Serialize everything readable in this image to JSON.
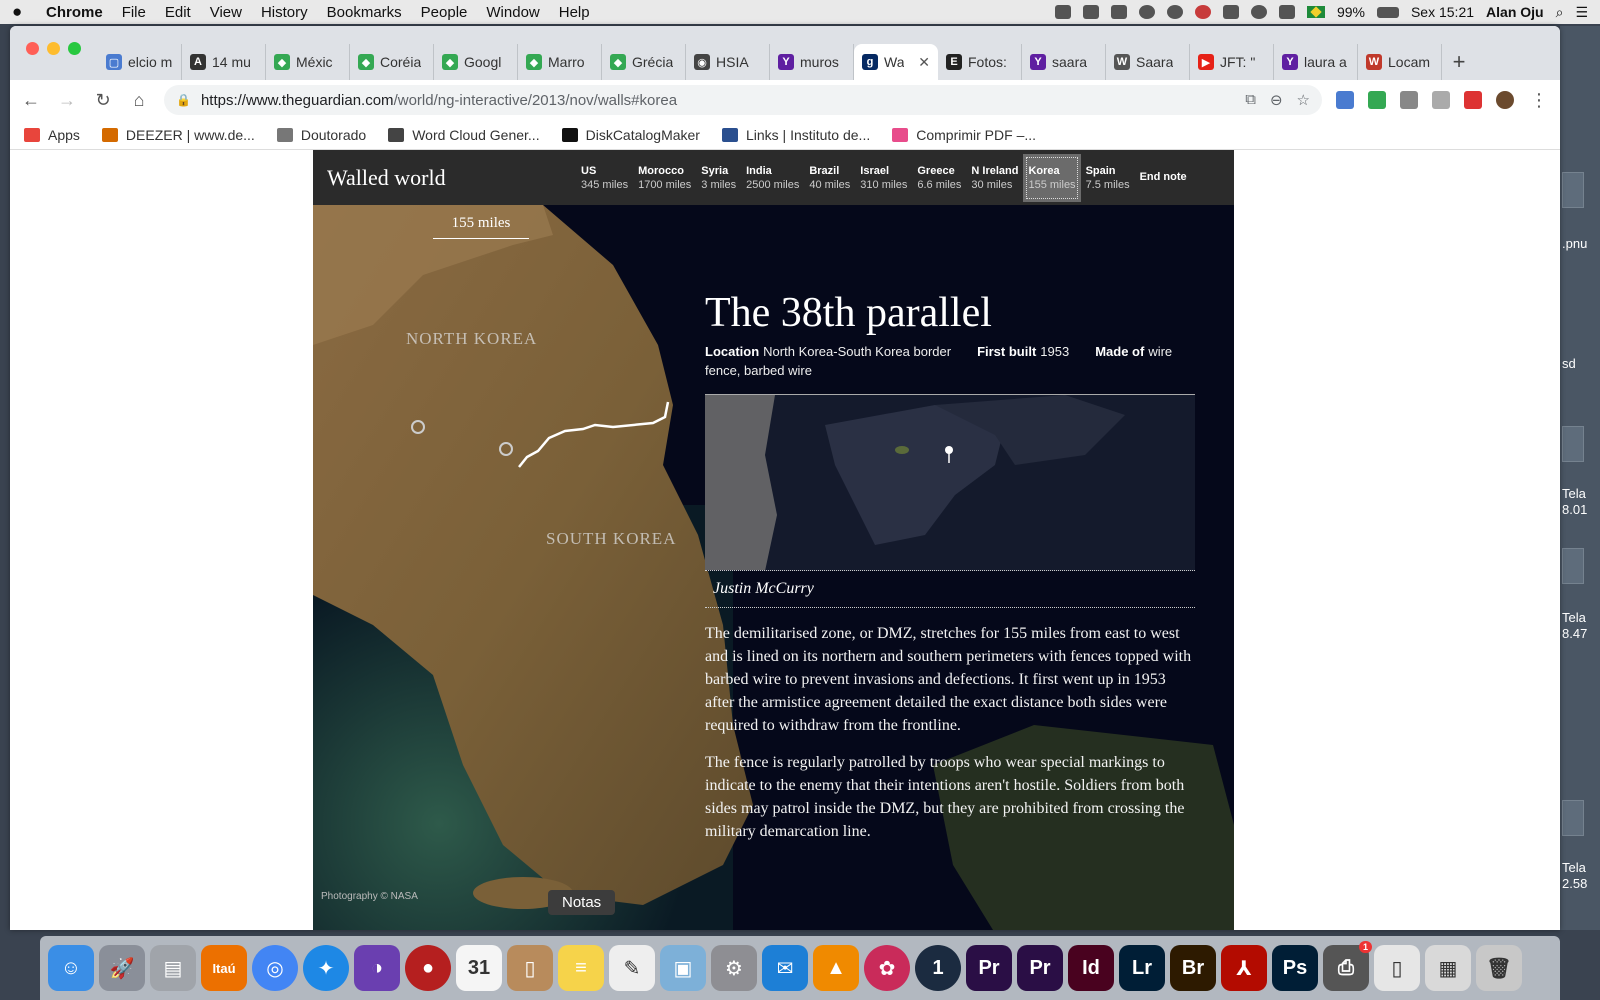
{
  "menubar": {
    "app": "Chrome",
    "items": [
      "File",
      "Edit",
      "View",
      "History",
      "Bookmarks",
      "People",
      "Window",
      "Help"
    ],
    "battery": "99%",
    "clock": "Sex 15:21",
    "user": "Alan Oju"
  },
  "tabs": [
    {
      "label": "elcio m",
      "color": "#4a7bd0",
      "glyph": "▢"
    },
    {
      "label": "14 mu",
      "color": "#333333",
      "glyph": "A"
    },
    {
      "label": "Méxic",
      "color": "#34a853",
      "glyph": "◆"
    },
    {
      "label": "Coréia",
      "color": "#34a853",
      "glyph": "◆"
    },
    {
      "label": "Googl",
      "color": "#34a853",
      "glyph": "◆"
    },
    {
      "label": "Marro",
      "color": "#34a853",
      "glyph": "◆"
    },
    {
      "label": "Grécia",
      "color": "#34a853",
      "glyph": "◆"
    },
    {
      "label": "HSIA",
      "color": "#444444",
      "glyph": "◉"
    },
    {
      "label": "muros",
      "color": "#5f1fa1",
      "glyph": "Y"
    },
    {
      "label": "Wa",
      "color": "#052962",
      "glyph": "g",
      "active": true
    },
    {
      "label": "Fotos:",
      "color": "#222222",
      "glyph": "E"
    },
    {
      "label": "saara",
      "color": "#5f1fa1",
      "glyph": "Y"
    },
    {
      "label": "Saara",
      "color": "#555555",
      "glyph": "W"
    },
    {
      "label": "JFT: \"",
      "color": "#e62117",
      "glyph": "▶"
    },
    {
      "label": "laura a",
      "color": "#5f1fa1",
      "glyph": "Y"
    },
    {
      "label": "Locam",
      "color": "#c0392b",
      "glyph": "W"
    }
  ],
  "address": {
    "host": "https://www.theguardian.com",
    "path": "/world/ng-interactive/2013/nov/walls#korea"
  },
  "bookmarks": [
    {
      "label": "Apps",
      "color": "#e8453c"
    },
    {
      "label": "DEEZER | www.de...",
      "color": "#d46a00"
    },
    {
      "label": "Doutorado",
      "color": "#777777"
    },
    {
      "label": "Word Cloud Gener...",
      "color": "#444444"
    },
    {
      "label": "DiskCatalogMaker",
      "color": "#111111"
    },
    {
      "label": "Links | Instituto de...",
      "color": "#2a4f8f"
    },
    {
      "label": "Comprimir PDF –...",
      "color": "#e84c8b"
    }
  ],
  "article": {
    "site_title": "Walled world",
    "nav": [
      {
        "name": "US",
        "miles": "345 miles"
      },
      {
        "name": "Morocco",
        "miles": "1700 miles"
      },
      {
        "name": "Syria",
        "miles": "3 miles"
      },
      {
        "name": "India",
        "miles": "2500 miles"
      },
      {
        "name": "Brazil",
        "miles": "40 miles"
      },
      {
        "name": "Israel",
        "miles": "310 miles"
      },
      {
        "name": "Greece",
        "miles": "6.6 miles"
      },
      {
        "name": "N Ireland",
        "miles": "30 miles"
      },
      {
        "name": "Korea",
        "miles": "155 miles",
        "active": true
      },
      {
        "name": "Spain",
        "miles": "7.5 miles"
      },
      {
        "name": "End note",
        "miles": ""
      }
    ],
    "miles_tag": "155 miles",
    "map_label_north": "NORTH KOREA",
    "map_label_south": "SOUTH KOREA",
    "credit": "Photography © NASA",
    "headline": "The 38th parallel",
    "location_label": "Location",
    "location_value": "North Korea-South Korea border",
    "first_built_label": "First built",
    "first_built_value": "1953",
    "made_of_label": "Made of",
    "made_of_value": "wire fence, barbed wire",
    "byline": "Justin McCurry",
    "paragraphs": [
      "The demilitarised zone, or DMZ, stretches for 155 miles from east to west and is lined on its northern and southern perimeters with fences topped with barbed wire to prevent invasions and defections. It first went up in 1953 after the armistice agreement detailed the exact distance both sides were required to withdraw from the frontline.",
      "The fence is regularly patrolled by troops who wear special markings to indicate to the enemy that their intentions aren't hostile. Soldiers from both sides may patrol inside the DMZ, but they are prohibited from crossing the military demarcation line."
    ]
  },
  "desktop_labels": [
    ".pnu",
    "sd",
    "Tela\n8.01",
    "Tela\n8.47",
    "Tela\n2.58"
  ],
  "dock": {
    "tooltip": "Notas",
    "apps": [
      {
        "name": "finder",
        "color": "#3a8ee6",
        "glyph": "☺"
      },
      {
        "name": "launchpad",
        "color": "#8a8f99",
        "glyph": "🚀"
      },
      {
        "name": "archive",
        "color": "#a0a4aa",
        "glyph": "▤"
      },
      {
        "name": "itau",
        "color": "#ec7000",
        "glyph": "Itaú"
      },
      {
        "name": "chrome",
        "color": "#4285f4",
        "glyph": "◎"
      },
      {
        "name": "safari",
        "color": "#1e88e5",
        "glyph": "✦"
      },
      {
        "name": "color-picker",
        "color": "#6a3fb0",
        "glyph": "◑"
      },
      {
        "name": "record",
        "color": "#b51f1f",
        "glyph": "●"
      },
      {
        "name": "calendar",
        "color": "#f5f5f5",
        "glyph": "31"
      },
      {
        "name": "contacts",
        "color": "#b88b5c",
        "glyph": "▯"
      },
      {
        "name": "notes",
        "color": "#f6d34a",
        "glyph": "≡"
      },
      {
        "name": "textedit",
        "color": "#eeeeee",
        "glyph": "✎"
      },
      {
        "name": "preview",
        "color": "#7db0d8",
        "glyph": "▣"
      },
      {
        "name": "system-preferences",
        "color": "#8e8e93",
        "glyph": "⚙"
      },
      {
        "name": "mail-bird",
        "color": "#1d7fd6",
        "glyph": "✉"
      },
      {
        "name": "vlc",
        "color": "#f08a00",
        "glyph": "▲"
      },
      {
        "name": "davinci",
        "color": "#c92b5a",
        "glyph": "✿"
      },
      {
        "name": "1password",
        "color": "#1b2b40",
        "glyph": "1"
      },
      {
        "name": "premiere",
        "color": "#2a0e45",
        "glyph": "Pr"
      },
      {
        "name": "premiere-2",
        "color": "#2a0e45",
        "glyph": "Pr"
      },
      {
        "name": "indesign",
        "color": "#49021f",
        "glyph": "Id"
      },
      {
        "name": "lightroom",
        "color": "#001e36",
        "glyph": "Lr"
      },
      {
        "name": "bridge",
        "color": "#2d1a00",
        "glyph": "Br"
      },
      {
        "name": "acrobat",
        "color": "#b30b00",
        "glyph": "⅄"
      },
      {
        "name": "photoshop",
        "color": "#001e36",
        "glyph": "Ps"
      },
      {
        "name": "printer",
        "color": "#555555",
        "glyph": "⎙",
        "badge": "1"
      },
      {
        "name": "documents",
        "color": "#e6e6e6",
        "glyph": "▯"
      },
      {
        "name": "downloads",
        "color": "#d9d9d9",
        "glyph": "▦"
      },
      {
        "name": "trash",
        "color": "#c8c8c8",
        "glyph": "🗑"
      }
    ]
  }
}
